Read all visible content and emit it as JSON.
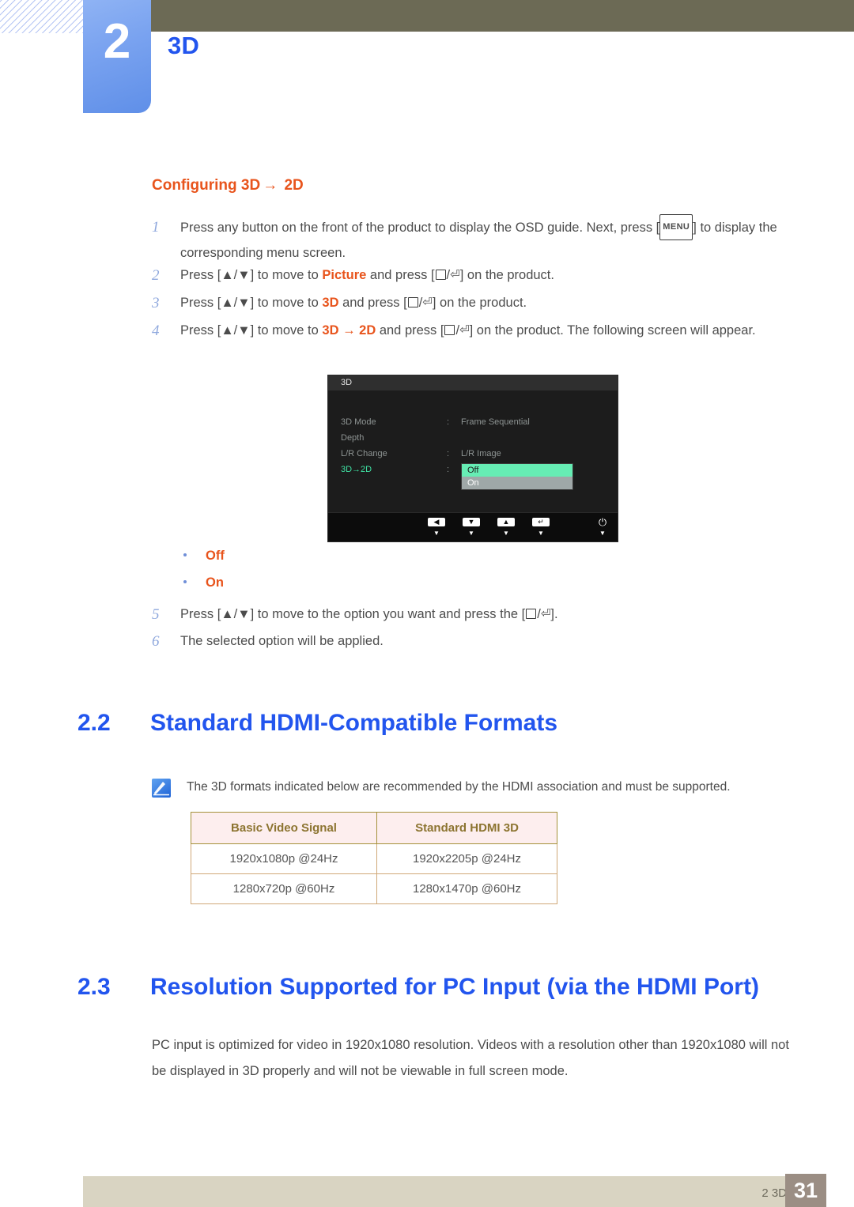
{
  "header": {
    "chapter_number": "2",
    "chapter_title": "3D"
  },
  "sub_heading": {
    "prefix": "Configuring 3D",
    "arrow": "→",
    "suffix": "2D"
  },
  "steps": [
    {
      "num": "1",
      "parts": [
        {
          "t": "Press any button on the front of the product to display the OSD guide. Next, press "
        },
        {
          "t": "[",
          "k": "plain"
        },
        {
          "t": "MENU",
          "k": "menukey"
        },
        {
          "t": "]",
          "k": "plain"
        },
        {
          "t": " to display the corresponding menu screen."
        }
      ]
    },
    {
      "num": "2",
      "parts": [
        {
          "t": "Press [▲/▼] to move to "
        },
        {
          "t": "Picture",
          "k": "hl"
        },
        {
          "t": " and press ["
        },
        {
          "t": "BOX",
          "k": "box"
        },
        {
          "t": "/"
        },
        {
          "t": "⏎",
          "k": "ent"
        },
        {
          "t": "] on the product."
        }
      ]
    },
    {
      "num": "3",
      "parts": [
        {
          "t": "Press [▲/▼] to move to "
        },
        {
          "t": "3D",
          "k": "hl"
        },
        {
          "t": " and press ["
        },
        {
          "t": "BOX",
          "k": "box"
        },
        {
          "t": "/"
        },
        {
          "t": "⏎",
          "k": "ent"
        },
        {
          "t": "] on the product."
        }
      ]
    },
    {
      "num": "4",
      "parts": [
        {
          "t": "Press [▲/▼] to move to "
        },
        {
          "t": "3D →  2D",
          "k": "hl"
        },
        {
          "t": " and press ["
        },
        {
          "t": "BOX",
          "k": "box"
        },
        {
          "t": "/"
        },
        {
          "t": "⏎",
          "k": "ent"
        },
        {
          "t": "] on the product. The following screen will appear."
        }
      ]
    },
    {
      "num": "5",
      "parts": [
        {
          "t": "Press [▲/▼] to move to the option you want and press the ["
        },
        {
          "t": "BOX",
          "k": "box"
        },
        {
          "t": "/"
        },
        {
          "t": "⏎",
          "k": "ent"
        },
        {
          "t": "]."
        }
      ]
    },
    {
      "num": "6",
      "parts": [
        {
          "t": "The selected option will be applied."
        }
      ]
    }
  ],
  "osd": {
    "title": "3D",
    "rows": [
      {
        "label": "3D Mode",
        "colon": ":",
        "value": "Frame Sequential",
        "active": false
      },
      {
        "label": "Depth",
        "colon": "",
        "value": "",
        "active": false
      },
      {
        "label": "L/R Change",
        "colon": ":",
        "value": "L/R Image",
        "active": false
      },
      {
        "label": "3D→2D",
        "colon": ":",
        "value": "",
        "active": true
      }
    ],
    "dropdown": {
      "options": [
        {
          "label": "Off",
          "state": "selected"
        },
        {
          "label": "On",
          "state": "unselected"
        }
      ]
    },
    "footer_buttons": [
      {
        "glyph": "◀",
        "name": "left-arrow"
      },
      {
        "glyph": "▼",
        "name": "down-arrow"
      },
      {
        "glyph": "▲",
        "name": "up-arrow"
      },
      {
        "glyph": "↵",
        "name": "enter"
      },
      {
        "glyph": "⏻",
        "name": "power"
      }
    ]
  },
  "bullets": [
    {
      "label": "Off"
    },
    {
      "label": "On"
    }
  ],
  "sections": [
    {
      "number": "2.2",
      "title": "Standard HDMI-Compatible Formats"
    },
    {
      "number": "2.3",
      "title": "Resolution Supported for PC Input (via the HDMI Port)"
    }
  ],
  "note": {
    "text": "The 3D formats indicated below are recommended by the HDMI association and must be supported."
  },
  "table": {
    "headers": [
      "Basic Video Signal",
      "Standard HDMI 3D"
    ],
    "rows": [
      [
        "1920x1080p @24Hz",
        "1920x2205p @24Hz"
      ],
      [
        "1280x720p @60Hz",
        "1280x1470p @60Hz"
      ]
    ]
  },
  "paragraph": {
    "text": "PC input is optimized for video in 1920x1080 resolution. Videos with a resolution other than 1920x1080 will not be displayed in 3D properly and will not be viewable in full screen mode."
  },
  "footer": {
    "label": "2 3D",
    "page": "31"
  },
  "colors": {
    "accent_blue": "#2255ee",
    "accent_orange": "#e8541c",
    "olive_bar": "#6c6a55",
    "tab_blue": "#7aa3f0",
    "osd_green": "#66edb4",
    "footer_bar": "#d9d4c2",
    "footer_page_box": "#9b8e84",
    "table_header_bg": "#fdeeee",
    "table_header_text": "#8c7430"
  }
}
